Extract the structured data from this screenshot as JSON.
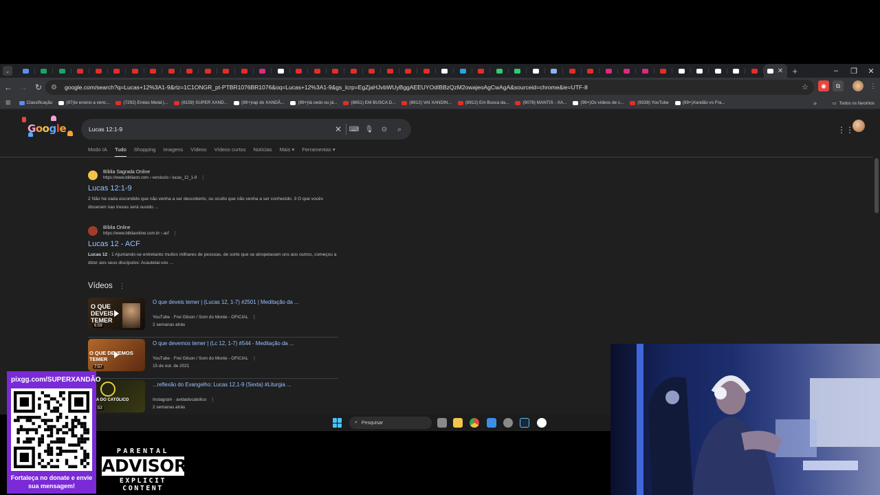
{
  "browser": {
    "tab_favicon_colors": [
      "#5b8def",
      "#1aa36b",
      "#1aa36b",
      "#e52d27",
      "#e52d27",
      "#e52d27",
      "#e52d27",
      "#e52d27",
      "#e52d27",
      "#e52d27",
      "#e52d27",
      "#e52d27",
      "#e52d27",
      "#dd2a7b",
      "#ffffff",
      "#e52d27",
      "#e52d27",
      "#e52d27",
      "#e52d27",
      "#e52d27",
      "#e52d27",
      "#e52d27",
      "#e52d27",
      "#ffffff",
      "#2aa3e0",
      "#e52d27",
      "#2ecc71",
      "#2ecc71",
      "#ffffff",
      "#8ab4f8",
      "#e52d27",
      "#e52d27",
      "#dd2a7b",
      "#dd2a7b",
      "#dd2a7b",
      "#e52d27",
      "#ffffff",
      "#ffffff",
      "#ffffff",
      "#ffffff",
      "#e52d27",
      "#ffffff"
    ],
    "new_tab_label": "+",
    "url": "google.com/search?q=Lucas+12%3A1-9&rlz=1C1ONGR_pt-PTBR1076BR1076&oq=Lucas+12%3A1-9&gs_lcrp=EgZjaHJvbWUyBggAEEUYOdIBBzQzM2owajeoAgCwAgA&sourceid=chrome&ie=UTF-8",
    "bookmarks": [
      {
        "label": "Classificação",
        "color": "#5b8def"
      },
      {
        "label": "(97)Ie ensino a venc...",
        "color": "#ffffff"
      },
      {
        "label": "(7292) Enéas Metal |...",
        "color": "#e52d27"
      },
      {
        "label": "(8159) SUPER XAND...",
        "color": "#e52d27"
      },
      {
        "label": "(99+)rap do XANDÃ...",
        "color": "#ffffff"
      },
      {
        "label": "(99+)tá cedo ou já...",
        "color": "#ffffff"
      },
      {
        "label": "(8851) EM BUSCA D...",
        "color": "#e52d27"
      },
      {
        "label": "(8912) VAI XANDIN...",
        "color": "#e52d27"
      },
      {
        "label": "(8912) Em Busca da...",
        "color": "#e52d27"
      },
      {
        "label": "(9078) MANTIS - XA...",
        "color": "#e52d27"
      },
      {
        "label": "(99+)Os vídeos de c...",
        "color": "#ffffff"
      },
      {
        "label": "(9338) YouTube",
        "color": "#e52d27"
      },
      {
        "label": "(99+)Xandão vs Fra...",
        "color": "#ffffff"
      }
    ],
    "bookmarks_more": "»",
    "all_bookmarks": "Todos os favoritos"
  },
  "search": {
    "logo_text": "Google",
    "query": "Lucas 12:1-9",
    "tabs": [
      "Modo IA",
      "Tudo",
      "Shopping",
      "Imagens",
      "Vídeos",
      "Vídeos curtos",
      "Notícias",
      "Mais ▾",
      "Ferramentas ▾"
    ],
    "results": [
      {
        "site": "Bíblia Sagrada Online",
        "url": "https://www.bibliaon.com › versiculo › lucas_12_1-9",
        "title": "Lucas 12:1-9",
        "snippet_bold": "",
        "snippet": "2 Não há nada escondido que não venha a ser descoberto, ou oculto que não venha a ser conhecido. 3 O que vocês disseram nas trevas será ouvido ...",
        "favicon_color": "#f3c34a"
      },
      {
        "site": "Bíblia Online",
        "url": "https://www.bibliaonline.com.br › acf",
        "title": "Lucas 12 - ACF",
        "snippet_bold": "Lucas 12",
        "snippet": " · 1 Ajuntando-se entretanto muitos milhares de pessoas, de sorte que se atropelavam uns aos outros, começou a dizer aos seus discípulos: Acautelai-vos ...",
        "favicon_color": "#a23b2a"
      }
    ],
    "videos_heading": "Vídeos",
    "videos": [
      {
        "title": "O que deveis temer | (Lucas 12, 1-7) #2501 | Meditação da ...",
        "source": "YouTube · Frei Gilson / Som do Monte - OFICIAL",
        "date": "2 semanas atrás",
        "duration": "6:59",
        "thumb_text": "O QUE DEVEIS TEMER"
      },
      {
        "title": "O que devemos temer | (Lc 12, 1-7) #544 - Meditação da ...",
        "source": "YouTube · Frei Gilson / Som do Monte - OFICIAL",
        "date": "15 de out. de 2021",
        "duration": "7:57",
        "thumb_text": "O QUE DEVEMOS TEMER"
      },
      {
        "title": "...reflexão do Evangelho: Lucas 12,1-9 (Sexta) #Liturgia ...",
        "source": "Instagram · avidadocatolico",
        "date": "2 semanas atrás",
        "duration": "1:53",
        "thumb_text": "VIDA DO CATÓLICO"
      }
    ]
  },
  "taskbar": {
    "search_placeholder": "Pesquisar"
  },
  "overlay": {
    "donate_url": "pixgg.com/SUPERXANDÃO",
    "donate_message": "Fortaleça no donate e envie sua mensagem!",
    "advisory_line1": "PARENTAL",
    "advisory_line2": "ADVISORY",
    "advisory_line3": "EXPLICIT CONTENT"
  }
}
